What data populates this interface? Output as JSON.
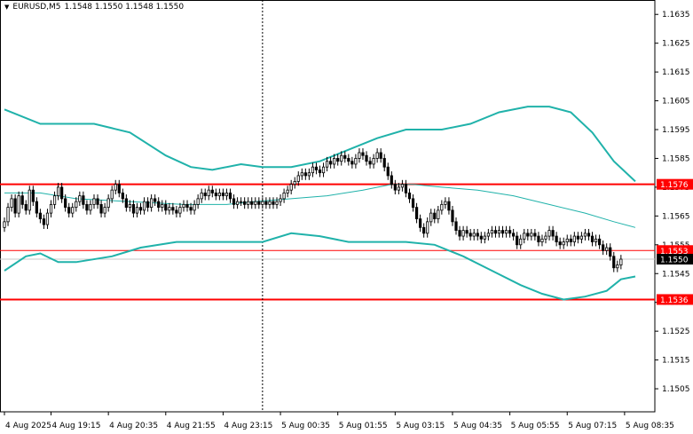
{
  "header": {
    "symbol": "EURUSD,M5",
    "ohlc": "1.1548 1.1550 1.1548 1.1550",
    "dropdown_icon": "triangle-down-icon"
  },
  "colors": {
    "candles": "#000000",
    "bollinger": "#20b2aa",
    "level_lines": "#ff0000",
    "level_tag": "#ff0000",
    "price_tag": "#000000",
    "grid": "#c8c8c8",
    "vline": "#000000"
  },
  "chart_data": {
    "type": "candlestick",
    "symbol": "EURUSD",
    "timeframe": "M5",
    "ylim": [
      1.1497,
      1.164
    ],
    "y_ticks": [
      "1.1635",
      "1.1625",
      "1.1615",
      "1.1605",
      "1.1595",
      "1.1585",
      "1.1575",
      "1.1565",
      "1.1555",
      "1.1545",
      "1.1535",
      "1.1525",
      "1.1515",
      "1.1505"
    ],
    "x_ticks": [
      {
        "label": "4 Aug 2025",
        "i": 0
      },
      {
        "label": "4 Aug 19:15",
        "i": 13
      },
      {
        "label": "4 Aug 20:35",
        "i": 29
      },
      {
        "label": "4 Aug 21:55",
        "i": 45
      },
      {
        "label": "4 Aug 23:15",
        "i": 61
      },
      {
        "label": "5 Aug 00:35",
        "i": 77
      },
      {
        "label": "5 Aug 01:55",
        "i": 93
      },
      {
        "label": "5 Aug 03:15",
        "i": 109
      },
      {
        "label": "5 Aug 04:35",
        "i": 125
      },
      {
        "label": "5 Aug 05:55",
        "i": 141
      },
      {
        "label": "5 Aug 07:15",
        "i": 157
      },
      {
        "label": "5 Aug 08:35",
        "i": 173
      }
    ],
    "levels": [
      {
        "price": 1.1576,
        "label": "1.1576"
      },
      {
        "price": 1.1553,
        "label": "1.1553"
      },
      {
        "price": 1.1536,
        "label": "1.1536"
      }
    ],
    "current_price": {
      "price": 1.155,
      "label": "1.1550"
    },
    "vertical_line_i": 72,
    "candle_closes": [
      1.1563,
      1.1568,
      1.1571,
      1.1566,
      1.1572,
      1.1569,
      1.1567,
      1.1574,
      1.157,
      1.1566,
      1.1564,
      1.1562,
      1.1566,
      1.1569,
      1.1572,
      1.1575,
      1.1571,
      1.1568,
      1.1566,
      1.1568,
      1.157,
      1.1572,
      1.1569,
      1.1567,
      1.1569,
      1.1571,
      1.1569,
      1.1566,
      1.1568,
      1.1571,
      1.1574,
      1.1576,
      1.1573,
      1.1571,
      1.1568,
      1.1569,
      1.1566,
      1.1568,
      1.1567,
      1.157,
      1.1568,
      1.1571,
      1.157,
      1.1568,
      1.1569,
      1.1567,
      1.1568,
      1.1567,
      1.1566,
      1.1568,
      1.1569,
      1.1568,
      1.1567,
      1.1569,
      1.1571,
      1.1573,
      1.1572,
      1.1574,
      1.1573,
      1.1572,
      1.1573,
      1.1572,
      1.1573,
      1.1571,
      1.1569,
      1.157,
      1.157,
      1.1569,
      1.157,
      1.1569,
      1.157,
      1.1569,
      1.157,
      1.1569,
      1.157,
      1.1569,
      1.157,
      1.1571,
      1.1573,
      1.1574,
      1.1576,
      1.1577,
      1.1579,
      1.158,
      1.1579,
      1.158,
      1.1582,
      1.1581,
      1.158,
      1.1582,
      1.1584,
      1.1583,
      1.1585,
      1.1584,
      1.1586,
      1.1585,
      1.1584,
      1.1583,
      1.1585,
      1.1587,
      1.1586,
      1.1584,
      1.1583,
      1.1585,
      1.1587,
      1.1585,
      1.1582,
      1.1579,
      1.1576,
      1.1574,
      1.1575,
      1.1576,
      1.1573,
      1.1571,
      1.1568,
      1.1564,
      1.1561,
      1.1559,
      1.1563,
      1.1566,
      1.1564,
      1.1567,
      1.1569,
      1.157,
      1.1567,
      1.1563,
      1.156,
      1.1558,
      1.156,
      1.1559,
      1.1558,
      1.1559,
      1.1558,
      1.1557,
      1.1558,
      1.1559,
      1.156,
      1.1559,
      1.156,
      1.1559,
      1.156,
      1.1559,
      1.1558,
      1.1555,
      1.1557,
      1.1559,
      1.1558,
      1.1559,
      1.1558,
      1.1556,
      1.1557,
      1.1558,
      1.156,
      1.1558,
      1.1556,
      1.1555,
      1.1556,
      1.1557,
      1.1556,
      1.1558,
      1.1557,
      1.1558,
      1.1559,
      1.1558,
      1.1556,
      1.1557,
      1.1555,
      1.1553,
      1.1554,
      1.1551,
      1.1547,
      1.1548,
      1.155
    ],
    "bb_upper": [
      [
        0,
        1.1602
      ],
      [
        10,
        1.1597
      ],
      [
        25,
        1.1597
      ],
      [
        35,
        1.1594
      ],
      [
        45,
        1.1586
      ],
      [
        52,
        1.1582
      ],
      [
        58,
        1.1581
      ],
      [
        66,
        1.1583
      ],
      [
        72,
        1.1582
      ],
      [
        80,
        1.1582
      ],
      [
        88,
        1.1584
      ],
      [
        96,
        1.1588
      ],
      [
        104,
        1.1592
      ],
      [
        112,
        1.1595
      ],
      [
        122,
        1.1595
      ],
      [
        130,
        1.1597
      ],
      [
        138,
        1.1601
      ],
      [
        146,
        1.1603
      ],
      [
        152,
        1.1603
      ],
      [
        158,
        1.1601
      ],
      [
        164,
        1.1594
      ],
      [
        170,
        1.1584
      ],
      [
        176,
        1.1577
      ]
    ],
    "bb_mid": [
      [
        0,
        1.1573
      ],
      [
        10,
        1.1573
      ],
      [
        20,
        1.1571
      ],
      [
        35,
        1.157
      ],
      [
        50,
        1.1569
      ],
      [
        62,
        1.1569
      ],
      [
        70,
        1.157
      ],
      [
        80,
        1.1571
      ],
      [
        90,
        1.1572
      ],
      [
        100,
        1.1574
      ],
      [
        108,
        1.1576
      ],
      [
        114,
        1.1576
      ],
      [
        122,
        1.1575
      ],
      [
        132,
        1.1574
      ],
      [
        142,
        1.1572
      ],
      [
        152,
        1.1569
      ],
      [
        162,
        1.1566
      ],
      [
        170,
        1.1563
      ],
      [
        176,
        1.1561
      ]
    ],
    "bb_lower": [
      [
        0,
        1.1546
      ],
      [
        6,
        1.1551
      ],
      [
        10,
        1.1552
      ],
      [
        15,
        1.1549
      ],
      [
        20,
        1.1549
      ],
      [
        30,
        1.1551
      ],
      [
        38,
        1.1554
      ],
      [
        48,
        1.1556
      ],
      [
        62,
        1.1556
      ],
      [
        72,
        1.1556
      ],
      [
        80,
        1.1559
      ],
      [
        88,
        1.1558
      ],
      [
        96,
        1.1556
      ],
      [
        104,
        1.1556
      ],
      [
        112,
        1.1556
      ],
      [
        120,
        1.1555
      ],
      [
        128,
        1.1551
      ],
      [
        136,
        1.1546
      ],
      [
        144,
        1.1541
      ],
      [
        150,
        1.1538
      ],
      [
        156,
        1.1536
      ],
      [
        162,
        1.1537
      ],
      [
        168,
        1.1539
      ],
      [
        172,
        1.1543
      ],
      [
        176,
        1.1544
      ]
    ]
  }
}
